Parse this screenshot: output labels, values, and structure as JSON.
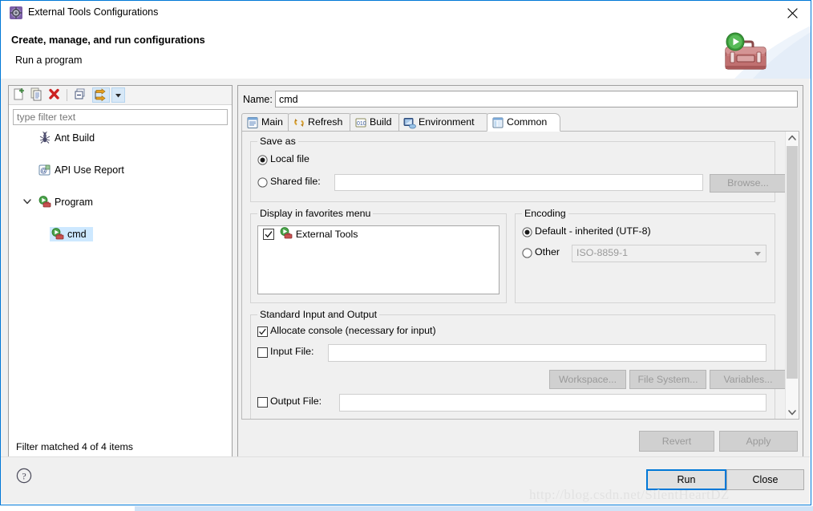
{
  "window": {
    "title": "External Tools Configurations",
    "title_icon": "gear-icon",
    "close_label": "✕",
    "accent_color": "#0078d7"
  },
  "header": {
    "title": "Create, manage, and run configurations",
    "subtitle": "Run a program",
    "banner_icon": "toolbox-with-run-icon"
  },
  "left_panel": {
    "toolbar": [
      {
        "name": "new-configuration-button",
        "icon": "new-document-icon"
      },
      {
        "name": "duplicate-configuration-button",
        "icon": "copy-icon"
      },
      {
        "name": "delete-configuration-button",
        "icon": "red-x-icon"
      },
      {
        "name": "collapse-all-button",
        "icon": "collapse-all-icon"
      },
      {
        "name": "filter-button",
        "icon": "filter-arrows-icon"
      },
      {
        "name": "filter-dropdown-button",
        "icon": "chevron-down-icon"
      }
    ],
    "filter": {
      "placeholder": "type filter text",
      "value": ""
    },
    "tree": [
      {
        "label": "Ant Build",
        "icon": "ant-icon",
        "indent": 36,
        "expandable": false,
        "selected": false
      },
      {
        "label": "API Use Report",
        "icon": "api-icon",
        "indent": 36,
        "expandable": false,
        "selected": false
      },
      {
        "label": "Program",
        "icon": "program-icon",
        "indent": 36,
        "expandable": true,
        "expanded": true,
        "selected": false
      },
      {
        "label": "cmd",
        "icon": "program-icon",
        "indent": 54,
        "expandable": false,
        "selected": true
      }
    ],
    "status": "Filter matched 4 of 4 items"
  },
  "right_panel": {
    "name_label": "Name:",
    "name_value": "cmd",
    "tabs": [
      {
        "label": "Main",
        "icon": "main-tab-icon",
        "selected": false
      },
      {
        "label": "Refresh",
        "icon": "refresh-tab-icon",
        "selected": false
      },
      {
        "label": "Build",
        "icon": "build-tab-icon",
        "selected": false
      },
      {
        "label": "Environment",
        "icon": "environment-tab-icon",
        "selected": false
      },
      {
        "label": "Common",
        "icon": "common-tab-icon",
        "selected": true
      }
    ],
    "common_tab": {
      "save_as": {
        "title": "Save as",
        "local_file": {
          "label": "Local file",
          "checked": true
        },
        "shared_file": {
          "label": "Shared file:",
          "checked": false,
          "value": ""
        },
        "browse_button": {
          "label": "Browse...",
          "enabled": false
        }
      },
      "favorites": {
        "title": "Display in favorites menu",
        "items": [
          {
            "label": "External Tools",
            "icon": "program-icon",
            "checked": true
          }
        ]
      },
      "encoding": {
        "title": "Encoding",
        "default_option": {
          "label": "Default - inherited (UTF-8)",
          "checked": true
        },
        "other_option": {
          "label": "Other",
          "checked": false
        },
        "other_value": "ISO-8859-1"
      },
      "stdio": {
        "title": "Standard Input and Output",
        "allocate_console": {
          "label": "Allocate console (necessary for input)",
          "checked": true
        },
        "input_file": {
          "label": "Input File:",
          "checked": false,
          "value": ""
        },
        "input_buttons": [
          {
            "label": "Workspace...",
            "enabled": false
          },
          {
            "label": "File System...",
            "enabled": false
          },
          {
            "label": "Variables...",
            "enabled": false
          }
        ],
        "output_file": {
          "label": "Output File:",
          "checked": false,
          "value": ""
        }
      }
    },
    "revert_button": {
      "label": "Revert",
      "enabled": false
    },
    "apply_button": {
      "label": "Apply",
      "enabled": false
    }
  },
  "footer": {
    "help_icon": "help-question-icon",
    "run_button": {
      "label": "Run",
      "default": true
    },
    "close_button": {
      "label": "Close"
    }
  },
  "watermark": "http://blog.csdn.net/SilentHeartDZ"
}
